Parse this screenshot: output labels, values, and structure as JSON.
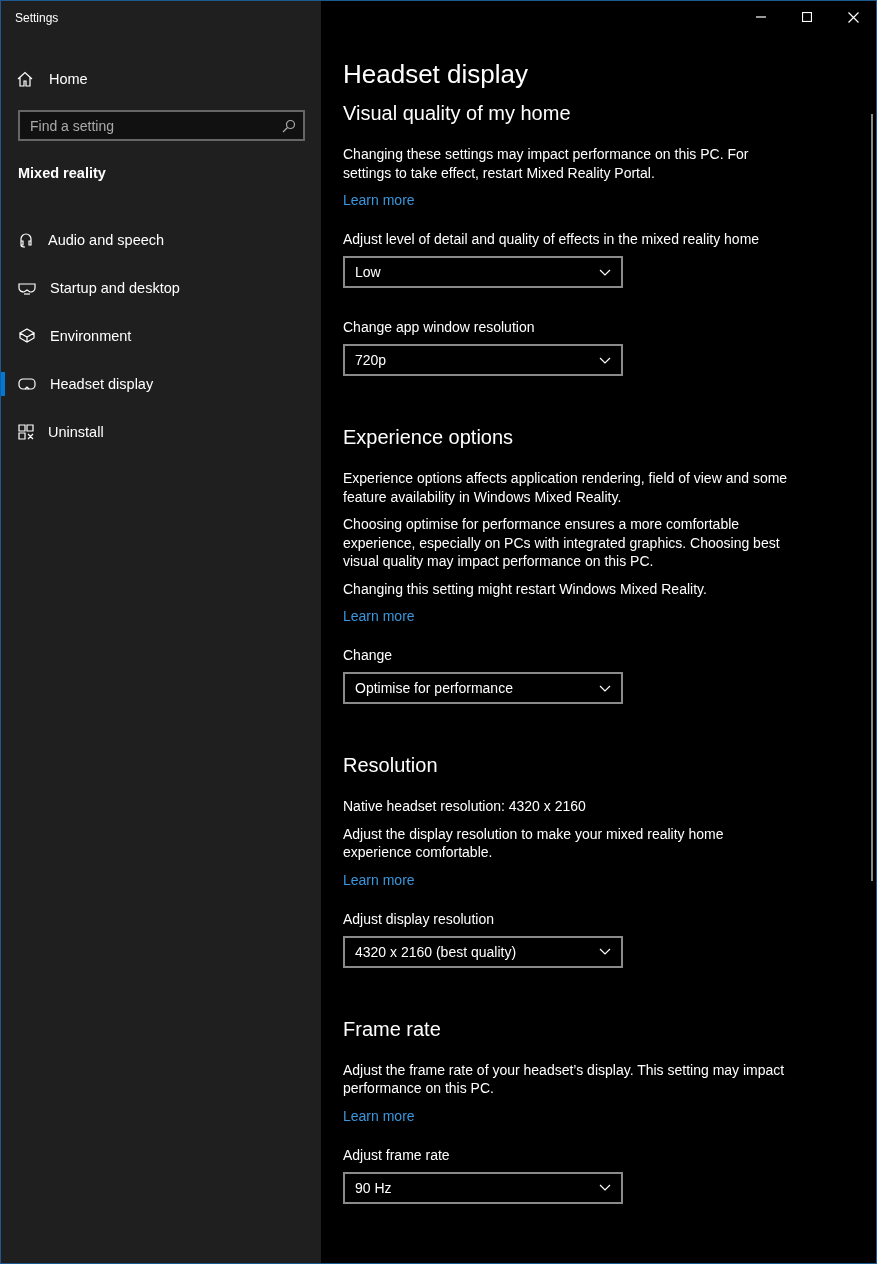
{
  "window": {
    "title": "Settings"
  },
  "sidebar": {
    "home": "Home",
    "search": {
      "placeholder": "Find a setting"
    },
    "section": "Mixed reality",
    "items": [
      {
        "kind": "audio",
        "label": "Audio and speech",
        "selected": false
      },
      {
        "kind": "startup",
        "label": "Startup and desktop",
        "selected": false
      },
      {
        "kind": "environment",
        "label": "Environment",
        "selected": false
      },
      {
        "kind": "headset",
        "label": "Headset display",
        "selected": true
      },
      {
        "kind": "uninstall",
        "label": "Uninstall",
        "selected": false
      }
    ]
  },
  "page": {
    "title": "Headset display",
    "sections": [
      {
        "heading": "Visual quality of my home",
        "blocks": [
          {
            "kind": "text",
            "text": "Changing these settings may impact performance on this PC. For settings to take effect, restart Mixed Reality Portal."
          },
          {
            "kind": "link",
            "text": "Learn more"
          },
          {
            "kind": "dropdown",
            "label": "Adjust level of detail and quality of effects in the mixed reality home",
            "value": "Low"
          },
          {
            "kind": "dropdown",
            "label": "Change app window resolution",
            "value": "720p"
          }
        ]
      },
      {
        "heading": "Experience options",
        "blocks": [
          {
            "kind": "text",
            "text": "Experience options affects application rendering, field of view and some feature availability in Windows Mixed Reality."
          },
          {
            "kind": "text",
            "text": "Choosing optimise for performance ensures a more comfortable experience, especially on PCs with integrated graphics. Choosing best visual quality may impact performance on this PC."
          },
          {
            "kind": "text",
            "text": "Changing this setting might restart Windows Mixed Reality."
          },
          {
            "kind": "link",
            "text": "Learn more"
          },
          {
            "kind": "dropdown",
            "label": "Change",
            "value": "Optimise for performance"
          }
        ]
      },
      {
        "heading": "Resolution",
        "blocks": [
          {
            "kind": "text",
            "text": "Native headset resolution: 4320 x 2160"
          },
          {
            "kind": "text",
            "text": "Adjust the display resolution to make your mixed reality home experience comfortable."
          },
          {
            "kind": "link",
            "text": "Learn more"
          },
          {
            "kind": "dropdown",
            "label": "Adjust display resolution",
            "value": "4320 x 2160 (best quality)"
          }
        ]
      },
      {
        "heading": "Frame rate",
        "blocks": [
          {
            "kind": "text",
            "text": "Adjust the frame rate of your headset’s display. This setting may impact performance on this PC."
          },
          {
            "kind": "link",
            "text": "Learn more"
          },
          {
            "kind": "dropdown",
            "label": "Adjust frame rate",
            "value": "90 Hz"
          }
        ]
      }
    ]
  }
}
